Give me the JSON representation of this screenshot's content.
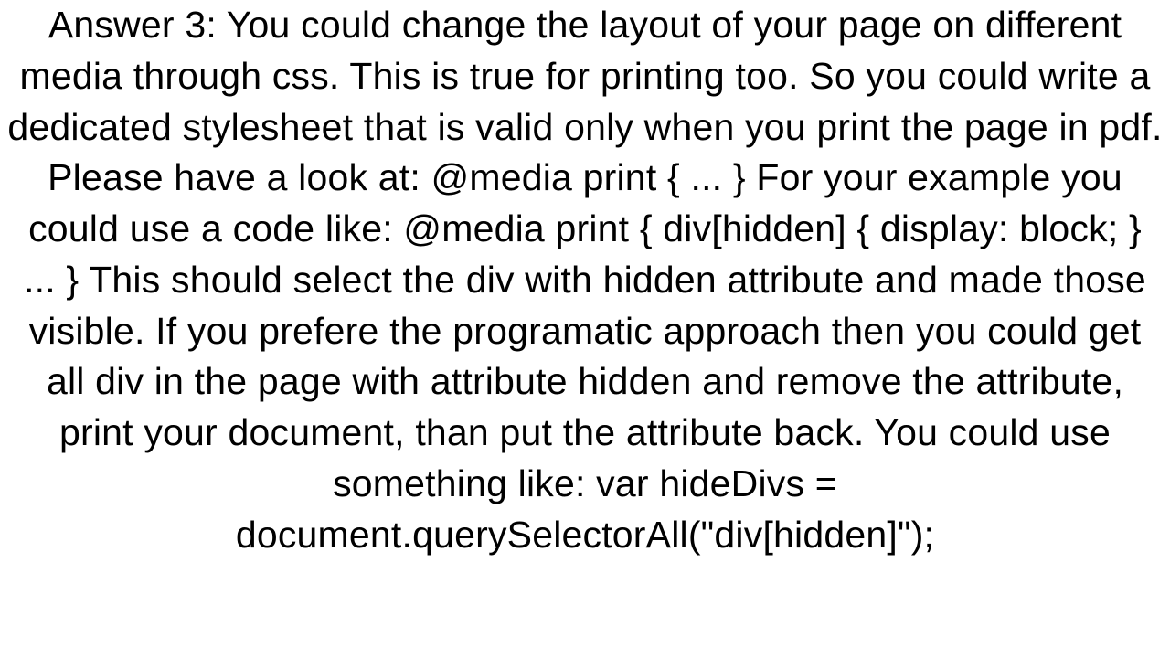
{
  "answer": {
    "text": "Answer 3: You could change the layout of your page on different media through css. This is true for printing too. So you could write a dedicated stylesheet that is valid only when you print the page in pdf. Please have a look at: @media print {     ... }  For your example you could use a code like: @media print {     div[hidden] {         display: block;     }     ... }  This should select the div with hidden attribute and made those visible. If you prefere the programatic approach then you could get all div in the page with attribute hidden and remove the attribute, print your document, than put the attribute back. You could use something like:  var hideDivs = document.querySelectorAll(\"div[hidden]\");"
  }
}
